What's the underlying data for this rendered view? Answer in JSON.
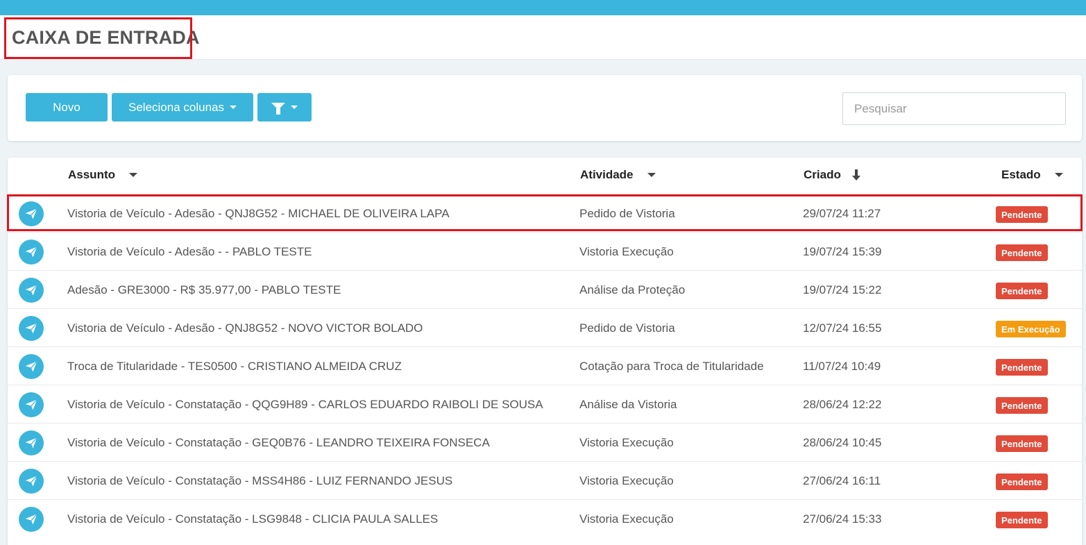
{
  "page": {
    "title": "CAIXA DE ENTRADA"
  },
  "colors": {
    "accent": "#3bb5db",
    "pendente": "#e04b3a",
    "em_execucao": "#f39c12",
    "highlight": "#e0141e"
  },
  "toolbar": {
    "novo_label": "Novo",
    "colunas_label": "Seleciona colunas",
    "filter_icon": "funnel-icon",
    "search_placeholder": "Pesquisar"
  },
  "table": {
    "headers": {
      "assunto": "Assunto",
      "atividade": "Atividade",
      "criado": "Criado",
      "estado": "Estado"
    },
    "rows": [
      {
        "icon": "paper-plane-icon",
        "assunto": "Vistoria de Veículo - Adesão - QNJ8G52 - MICHAEL DE OLIVEIRA LAPA",
        "atividade": "Pedido de Vistoria",
        "criado": "29/07/24 11:27",
        "estado": "Pendente",
        "estado_color": "#e04b3a"
      },
      {
        "icon": "paper-plane-icon",
        "assunto": "Vistoria de Veículo - Adesão -  - PABLO TESTE",
        "atividade": "Vistoria Execução",
        "criado": "19/07/24 15:39",
        "estado": "Pendente",
        "estado_color": "#e04b3a"
      },
      {
        "icon": "paper-plane-icon",
        "assunto": "Adesão - GRE3000 - R$ 35.977,00 - PABLO TESTE",
        "atividade": "Análise da Proteção",
        "criado": "19/07/24 15:22",
        "estado": "Pendente",
        "estado_color": "#e04b3a"
      },
      {
        "icon": "paper-plane-icon",
        "assunto": "Vistoria de Veículo - Adesão - QNJ8G52 - NOVO VICTOR BOLADO",
        "atividade": "Pedido de Vistoria",
        "criado": "12/07/24 16:55",
        "estado": "Em Execução",
        "estado_color": "#f39c12"
      },
      {
        "icon": "paper-plane-icon",
        "assunto": "Troca de Titularidade - TES0500 - CRISTIANO ALMEIDA CRUZ",
        "atividade": "Cotação para Troca de Titularidade",
        "criado": "11/07/24 10:49",
        "estado": "Pendente",
        "estado_color": "#e04b3a"
      },
      {
        "icon": "paper-plane-icon",
        "assunto": "Vistoria de Veículo - Constatação - QQG9H89 - CARLOS EDUARDO RAIBOLI DE SOUSA",
        "atividade": "Análise da Vistoria",
        "criado": "28/06/24 12:22",
        "estado": "Pendente",
        "estado_color": "#e04b3a"
      },
      {
        "icon": "paper-plane-icon",
        "assunto": "Vistoria de Veículo - Constatação - GEQ0B76 - LEANDRO TEIXEIRA FONSECA",
        "atividade": "Vistoria Execução",
        "criado": "28/06/24 10:45",
        "estado": "Pendente",
        "estado_color": "#e04b3a"
      },
      {
        "icon": "paper-plane-icon",
        "assunto": "Vistoria de Veículo - Constatação - MSS4H86 - LUIZ FERNANDO JESUS",
        "atividade": "Vistoria Execução",
        "criado": "27/06/24 16:11",
        "estado": "Pendente",
        "estado_color": "#e04b3a"
      },
      {
        "icon": "paper-plane-icon",
        "assunto": "Vistoria de Veículo - Constatação - LSG9848 - CLICIA PAULA SALLES",
        "atividade": "Vistoria Execução",
        "criado": "27/06/24 15:33",
        "estado": "Pendente",
        "estado_color": "#e04b3a"
      }
    ]
  }
}
